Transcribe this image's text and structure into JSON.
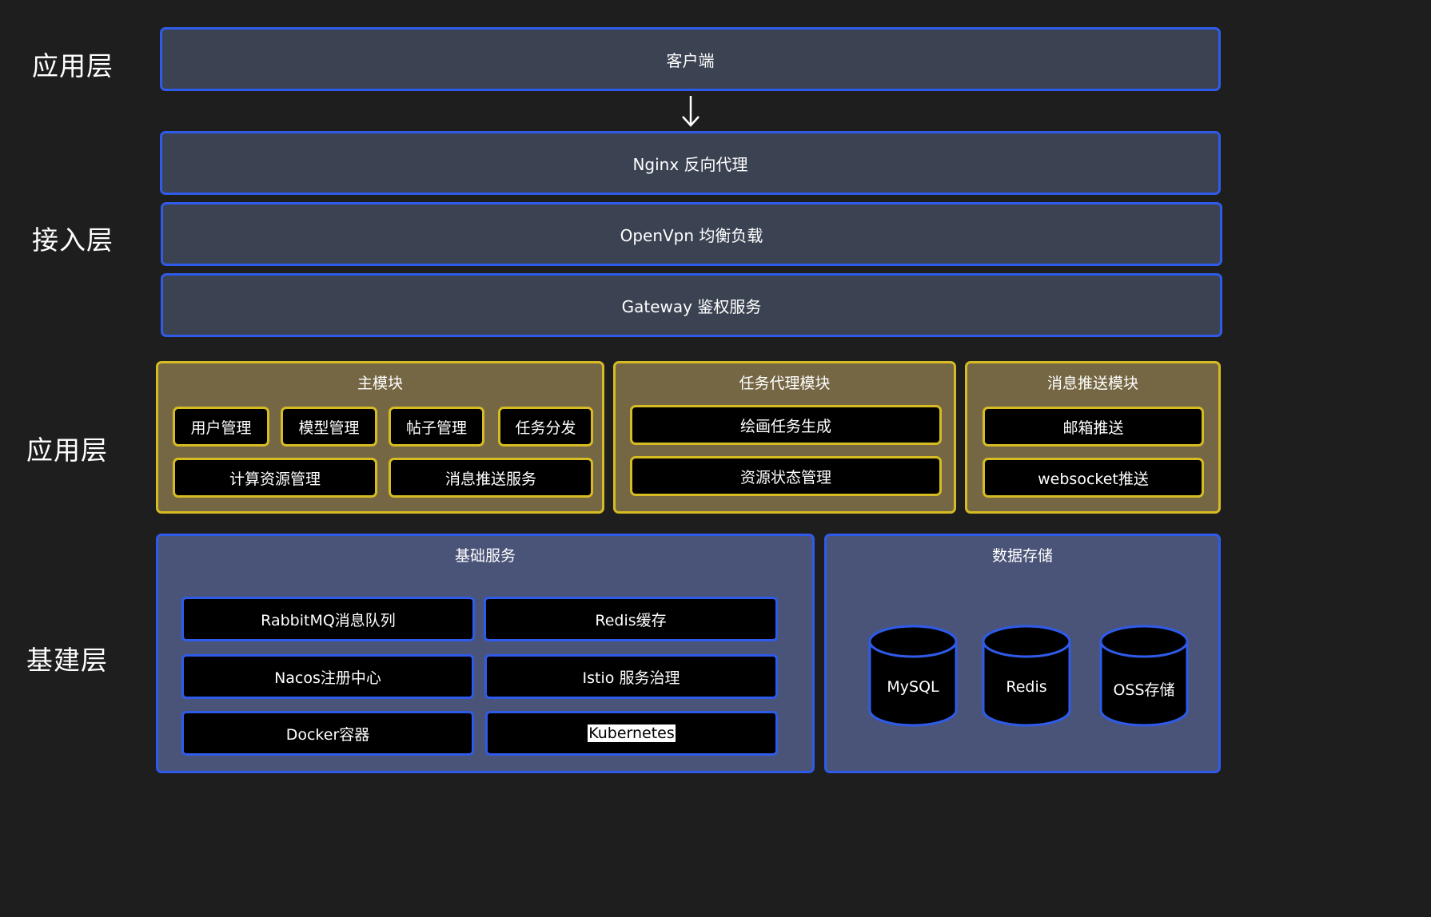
{
  "layers": {
    "app_top": "应用层",
    "access": "接入层",
    "app_mid": "应用层",
    "infra": "基建层"
  },
  "top": {
    "client": "客户端",
    "nginx": "Nginx 反向代理",
    "openvpn": "OpenVpn 均衡负载",
    "gateway": "Gateway 鉴权服务"
  },
  "modules": {
    "main": {
      "title": "主模块",
      "items": [
        "用户管理",
        "模型管理",
        "帖子管理",
        "任务分发",
        "计算资源管理",
        "消息推送服务"
      ]
    },
    "task_proxy": {
      "title": "任务代理模块",
      "items": [
        "绘画任务生成",
        "资源状态管理"
      ]
    },
    "msg_push": {
      "title": "消息推送模块",
      "items": [
        "邮箱推送",
        "websocket推送"
      ]
    }
  },
  "infra": {
    "base": {
      "title": "基础服务",
      "items": [
        "RabbitMQ消息队列",
        "Redis缓存",
        "Nacos注册中心",
        "Istio 服务治理",
        "Docker容器",
        "Kubernetes"
      ]
    },
    "storage": {
      "title": "数据存储",
      "items": [
        "MySQL",
        "Redis",
        "OSS存储"
      ]
    }
  },
  "colors": {
    "background": "#1e1e1e",
    "bar_fill": "#3b4352",
    "blue_border": "#2f5bea",
    "module_fill": "#756744",
    "module_border": "#d6bb22",
    "infra_fill": "#4a5478"
  },
  "icons": {
    "flow_arrow": "arrow-down-icon",
    "database": "database-cylinder-icon"
  }
}
